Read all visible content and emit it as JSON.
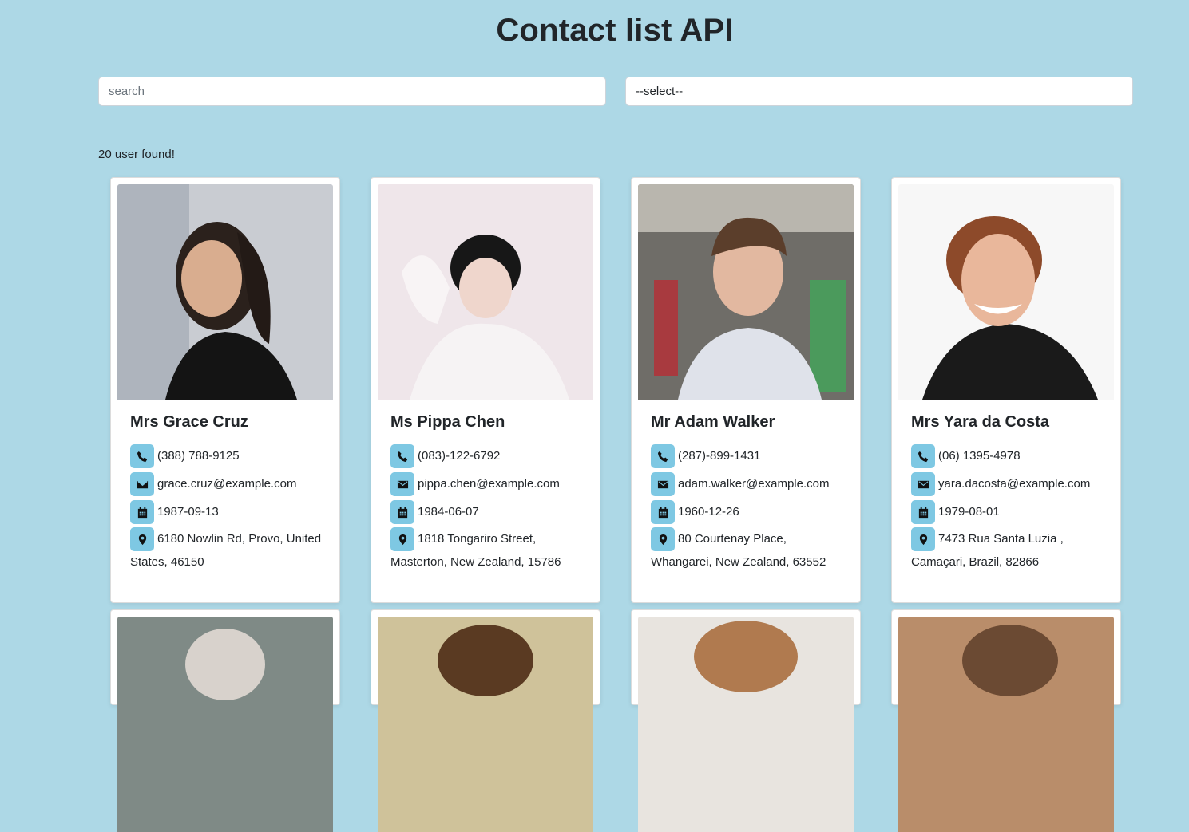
{
  "page": {
    "title": "Contact list API",
    "search_placeholder": "search",
    "select_value": "--select--",
    "count_text": "20 user found!"
  },
  "icons": {
    "phone": "phone-icon",
    "email": "envelope-icon",
    "dob": "calendar-icon",
    "address": "map-marker-icon"
  },
  "colors": {
    "background": "#add8e6",
    "icon_badge": "#7ec8e3"
  },
  "users": [
    {
      "name": "Mrs Grace Cruz",
      "phone": "(388) 788-9125",
      "email": "grace.cruz@example.com",
      "dob": "1987-09-13",
      "address": "6180 Nowlin Rd, Provo, United States, 46150"
    },
    {
      "name": "Ms Pippa Chen",
      "phone": "(083)-122-6792",
      "email": "pippa.chen@example.com",
      "dob": "1984-06-07",
      "address": "1818 Tongariro Street, Masterton, New Zealand, 15786"
    },
    {
      "name": "Mr Adam Walker",
      "phone": "(287)-899-1431",
      "email": "adam.walker@example.com",
      "dob": "1960-12-26",
      "address": "80 Courtenay Place, Whangarei, New Zealand, 63552"
    },
    {
      "name": "Mrs Yara da Costa",
      "phone": "(06) 1395-4978",
      "email": "yara.dacosta@example.com",
      "dob": "1979-08-01",
      "address": "7473 Rua Santa Luzia , Camaçari, Brazil, 82866"
    }
  ]
}
